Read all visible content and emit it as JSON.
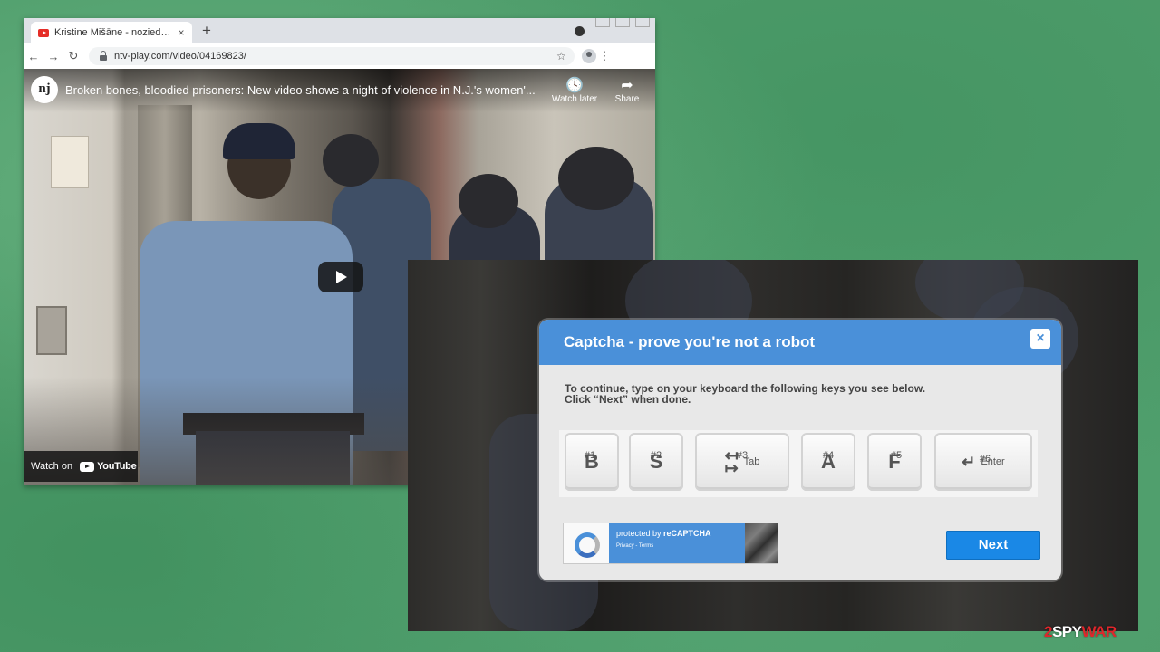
{
  "browser": {
    "tab_title": "Kristine Mišāne - noziedznieci!",
    "tab_close": "×",
    "new_tab": "+",
    "url": "ntv-play.com/video/04169823/"
  },
  "video": {
    "channel_logo": "nj",
    "title": "Broken bones, bloodied prisoners: New video shows a night of violence in N.J.'s women'...",
    "watch_later_label": "Watch later",
    "share_label": "Share",
    "watch_on_label": "Watch on",
    "youtube_label": "YouTube"
  },
  "captcha": {
    "header": "Captcha - prove you're not a robot",
    "close": "×",
    "instruction_line1": "To continue, type on your keyboard the following keys you see below.",
    "instruction_line2": "Click “Next” when done.",
    "keys": [
      {
        "label": "B",
        "num": "#1"
      },
      {
        "label": "S",
        "num": "#2"
      },
      {
        "label": "Tab",
        "num": "#3"
      },
      {
        "label": "A",
        "num": "#4"
      },
      {
        "label": "F",
        "num": "#5"
      },
      {
        "label": "Enter",
        "num": "#6"
      }
    ],
    "recaptcha_protected": "protected by",
    "recaptcha_brand": "reCAPTCHA",
    "recaptcha_links": "Privacy - Terms",
    "next_label": "Next"
  },
  "watermark": {
    "num": "2",
    "spy": "SPY",
    "war": "WAR"
  },
  "colors": {
    "background_green": "#4f9e6c",
    "captcha_header_blue": "#4a90d9",
    "next_button_blue": "#1a88e6",
    "youtube_red": "#e52d27"
  }
}
